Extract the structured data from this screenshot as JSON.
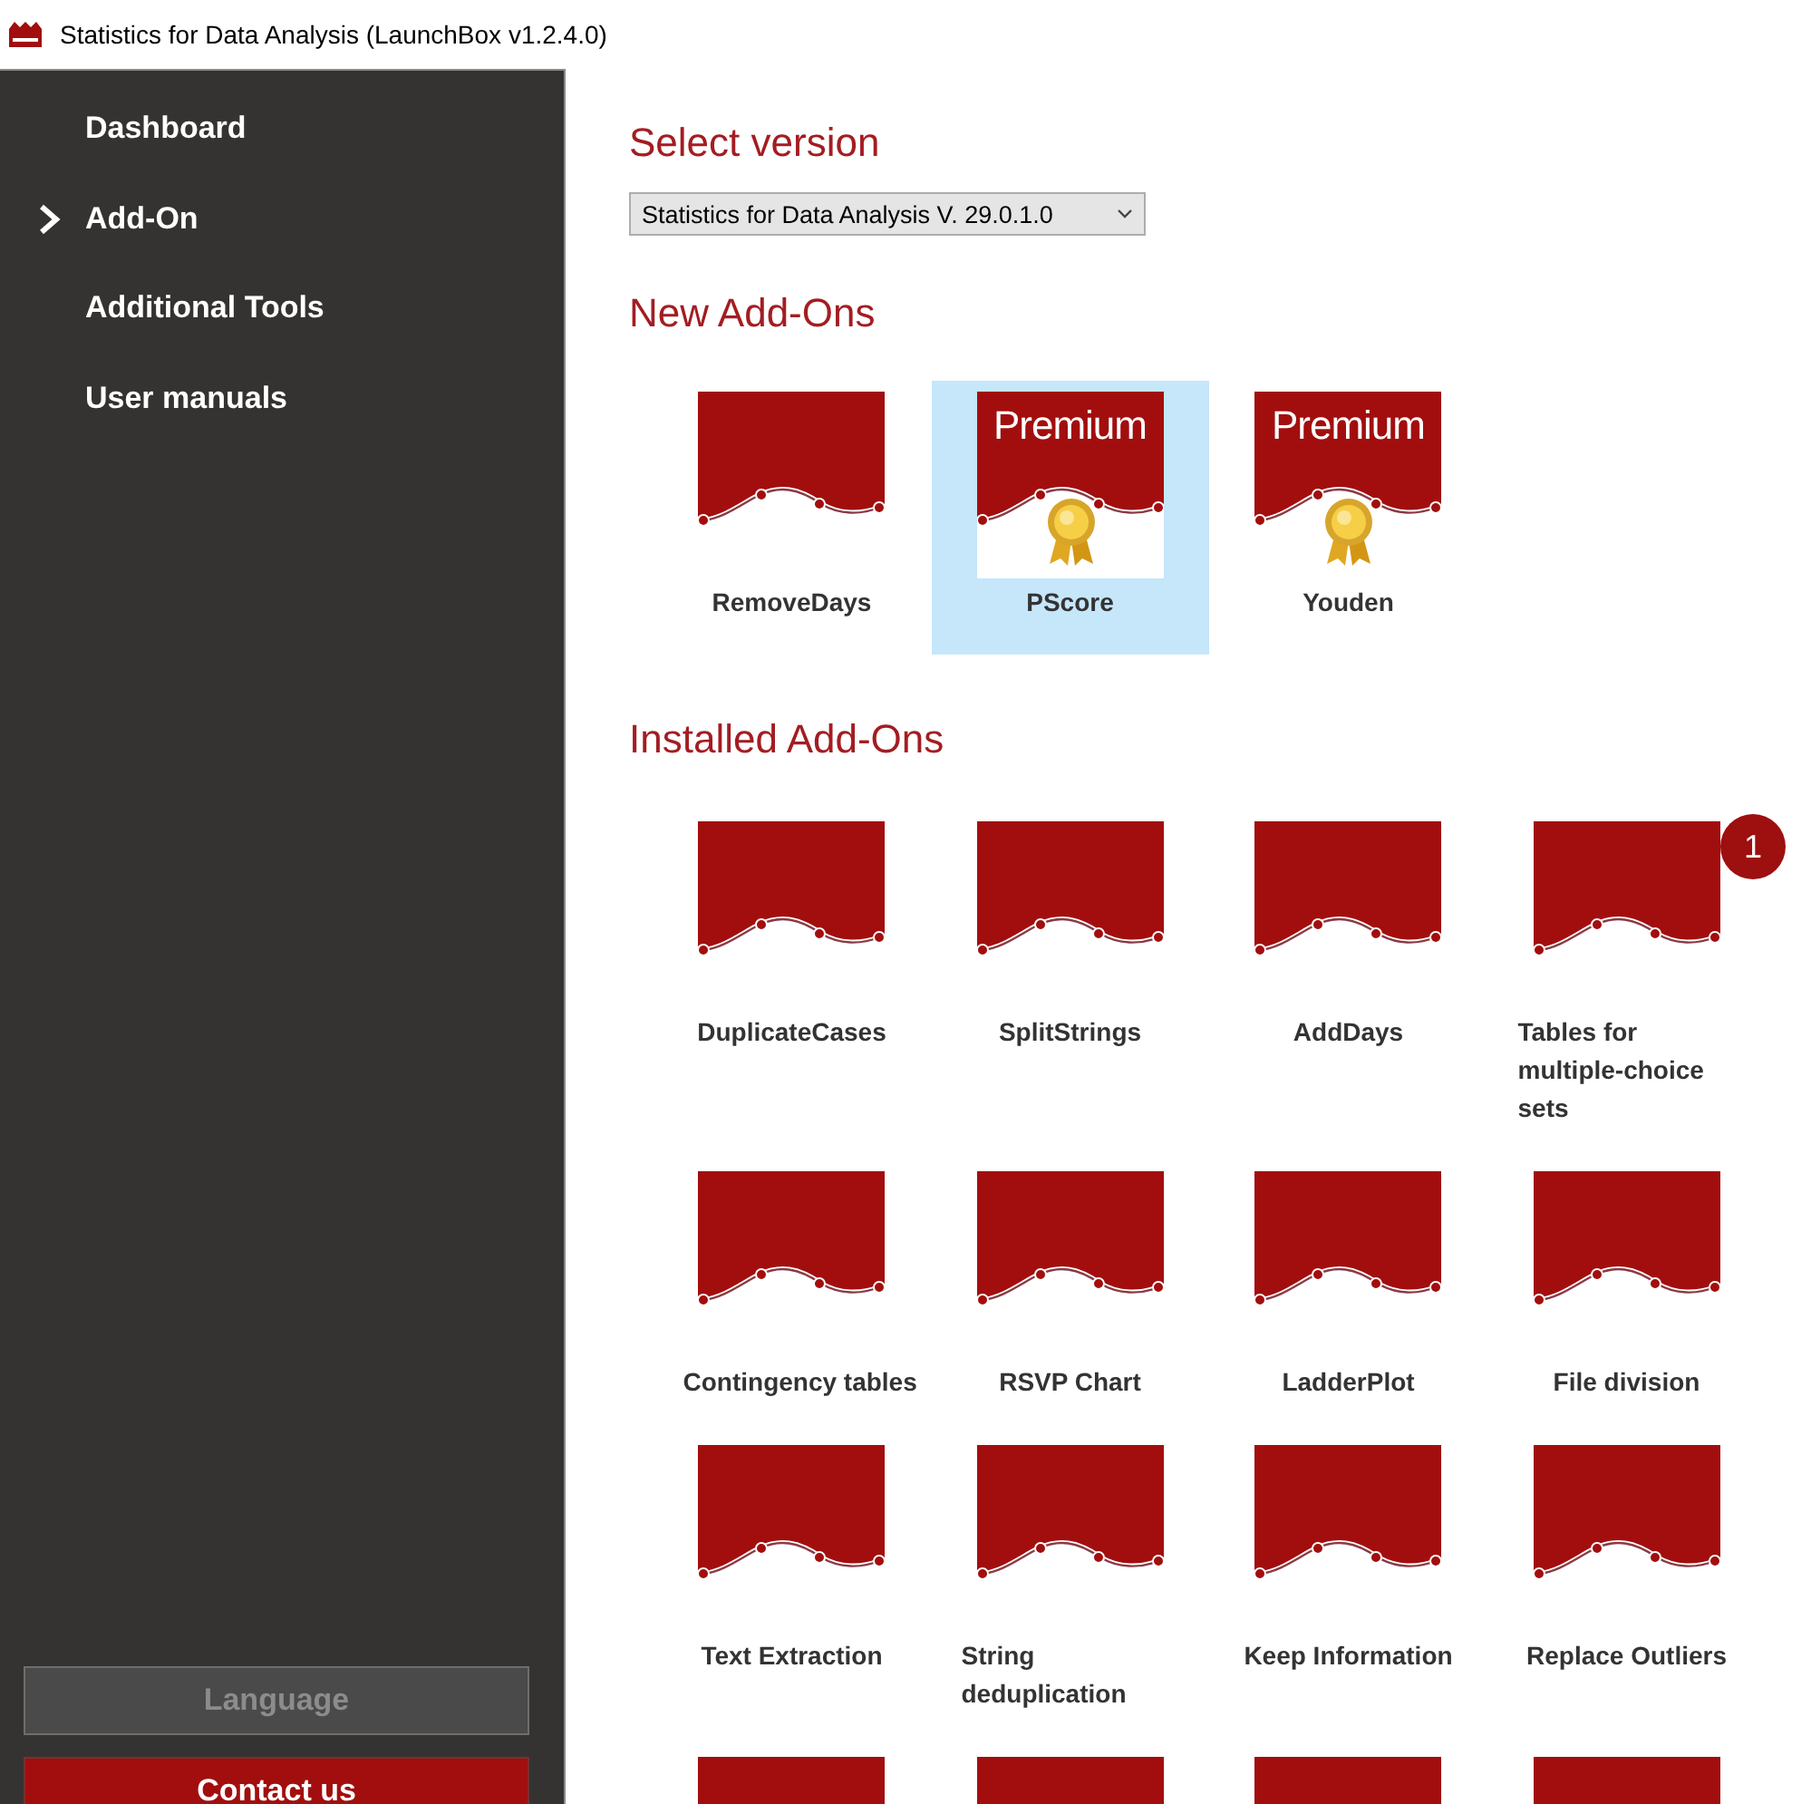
{
  "window": {
    "title": "Statistics for Data Analysis (LaunchBox v1.2.4.0)"
  },
  "sidebar": {
    "items": [
      {
        "label": "Dashboard",
        "selected": false
      },
      {
        "label": "Add-On",
        "selected": true
      },
      {
        "label": "Additional Tools",
        "selected": false
      },
      {
        "label": "User manuals",
        "selected": false
      }
    ],
    "language_button": {
      "label": "Language",
      "disabled": true
    },
    "contact_button": {
      "label": "Contact us"
    }
  },
  "main": {
    "version_heading": "Select version",
    "version_select": {
      "value": "Statistics for Data Analysis V. 29.0.1.0"
    },
    "sections": [
      {
        "heading": "New Add-Ons",
        "tiles": [
          {
            "label": "RemoveDays",
            "selected": false
          },
          {
            "label": "PScore",
            "premium": "Premium",
            "selected": true
          },
          {
            "label": "Youden",
            "premium": "Premium",
            "selected": false
          }
        ]
      },
      {
        "heading": "Installed Add-Ons",
        "tiles": [
          {
            "label": "DuplicateCases",
            "selected": false
          },
          {
            "label": "SplitStrings",
            "selected": false
          },
          {
            "label": "AddDays",
            "selected": false
          },
          {
            "label": "Tables for multiple-choice sets",
            "selected": false,
            "badge": "1"
          },
          {
            "label": "Contingency tables",
            "selected": false
          },
          {
            "label": "RSVP Chart",
            "selected": false
          },
          {
            "label": "LadderPlot",
            "selected": false
          },
          {
            "label": "File division",
            "selected": false
          },
          {
            "label": "Text Extraction",
            "selected": false
          },
          {
            "label": "String deduplication",
            "selected": false
          },
          {
            "label": "Keep Information",
            "selected": false
          },
          {
            "label": "Replace Outliers",
            "selected": false
          },
          {
            "selected": false
          },
          {
            "selected": false
          },
          {
            "selected": false
          },
          {
            "selected": false
          }
        ]
      }
    ]
  }
}
